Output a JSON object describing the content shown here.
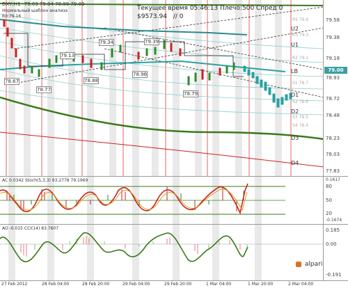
{
  "header": {
    "instrument": "DXY,H1",
    "ohlc": "79.03 79.04 78.99 79.00",
    "indicator_name": "Нормальный шаблон анализа",
    "indicator_value": "Вл:79.16",
    "status_line": "Текущее время 05:46:13 Плечо:500 Спред 0",
    "balance": "$9573.94",
    "balance_suffix": "// 0"
  },
  "main_chart": {
    "price_labels": [
      "78.67",
      "78.77",
      "79.13",
      "78.88",
      "79.34",
      "79.39",
      "78.96",
      "78.79"
    ],
    "level_labels": [
      "U2",
      "U1",
      "LB",
      "D1",
      "D2",
      "D3",
      "D4"
    ],
    "minor_labels": [
      "R5 79.6",
      "R3 79.3",
      "R2 79.1",
      "S1 78.7",
      "S2 78.6",
      "S3 78.5",
      "S4 78.4"
    ],
    "axis_ticks": [
      "79.58",
      "79.38",
      "79.18",
      "78.93",
      "78.72",
      "78.48",
      "78.23",
      "78.03",
      "77.83"
    ],
    "current_price": "79.00"
  },
  "ac_stoch": {
    "title": "AC 0.0342  Stoch(5,3,3) 93.2778 79.1969",
    "axis_ticks": [
      "80",
      "50",
      "20",
      "-0.1674"
    ],
    "axis_top": "0.1617"
  },
  "ao_cci": {
    "title": "AO -0.015  CCI(14) 83.7607",
    "axis_ticks": [
      "0.185",
      "0.00",
      "-0.191"
    ]
  },
  "time_axis": {
    "labels": [
      "27 Feb 2012",
      "28 Feb 04:00",
      "28 Feb 20:00",
      "29 Feb 04:00",
      "29 Feb 20:00",
      "1 Mar 04:00",
      "1 Mar 20:00",
      "2 Mar 04:00"
    ]
  },
  "brand": {
    "name": "alpari"
  },
  "colors": {
    "teal": "#2aa0a0",
    "green_line": "#3a7a1a",
    "red_line": "#cc2020",
    "stripe": "#e8e8e8",
    "accent_orange": "#e07020"
  }
}
